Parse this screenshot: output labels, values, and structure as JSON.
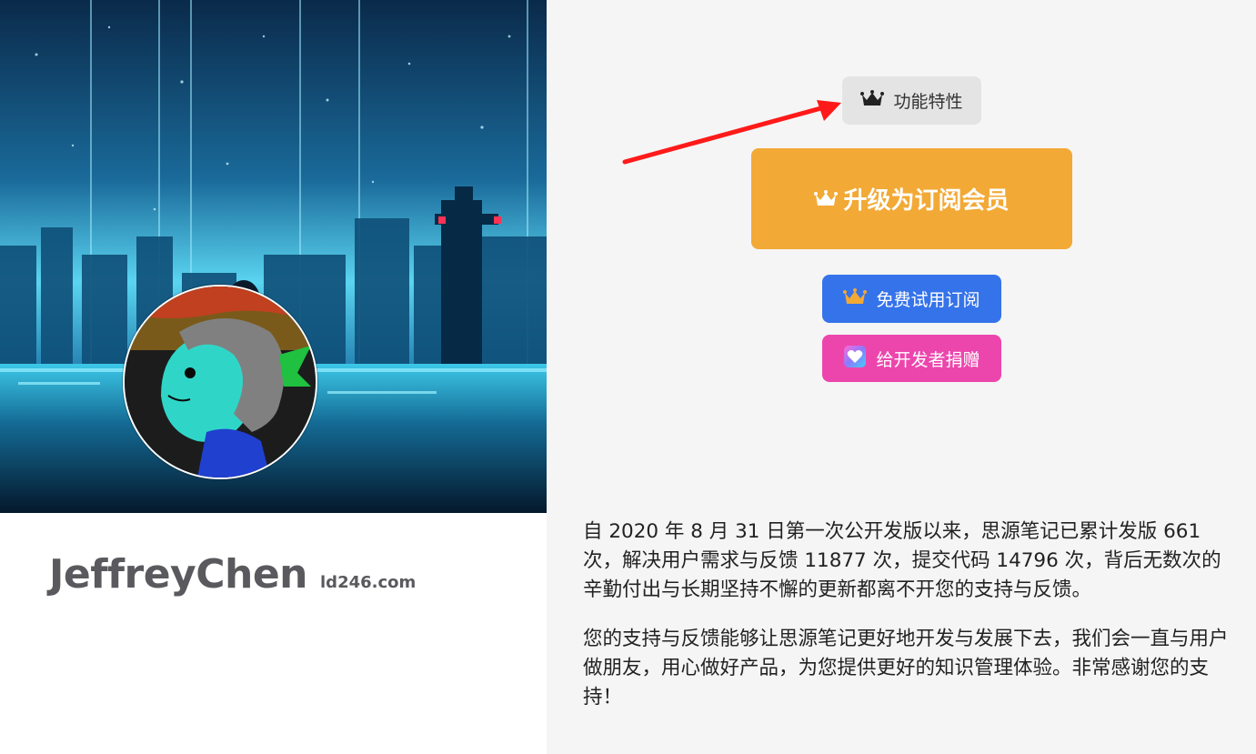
{
  "profile": {
    "name": "JeffreyChen",
    "site": "ld246.com"
  },
  "actions": {
    "features_label": "功能特性",
    "upgrade_label": "升级为订阅会员",
    "trial_label": "免费试用订阅",
    "donate_label": "给开发者捐赠"
  },
  "content": {
    "paragraph_1": "自 2020 年 8 月 31 日第一次公开发版以来，思源笔记已累计发版 661 次，解决用户需求与反馈 11877 次，提交代码 14796 次，背后无数次的辛勤付出与长期坚持不懈的更新都离不开您的支持与反馈。",
    "paragraph_2": "您的支持与反馈能够让思源笔记更好地开发与发展下去，我们会一直与用户做朋友，用心做好产品，为您提供更好的知识管理体验。非常感谢您的支持！"
  },
  "icons": {
    "features": "crown-icon",
    "upgrade": "crown-icon",
    "trial": "crown-icon",
    "donate": "heart-icon",
    "annotation": "red-arrow"
  },
  "colors": {
    "upgrade_bg": "#f2a935",
    "trial_bg": "#3573ea",
    "donate_bg": "#ec46ad",
    "features_bg": "#e4e4e4",
    "annotation_arrow": "#ff1a1a"
  }
}
